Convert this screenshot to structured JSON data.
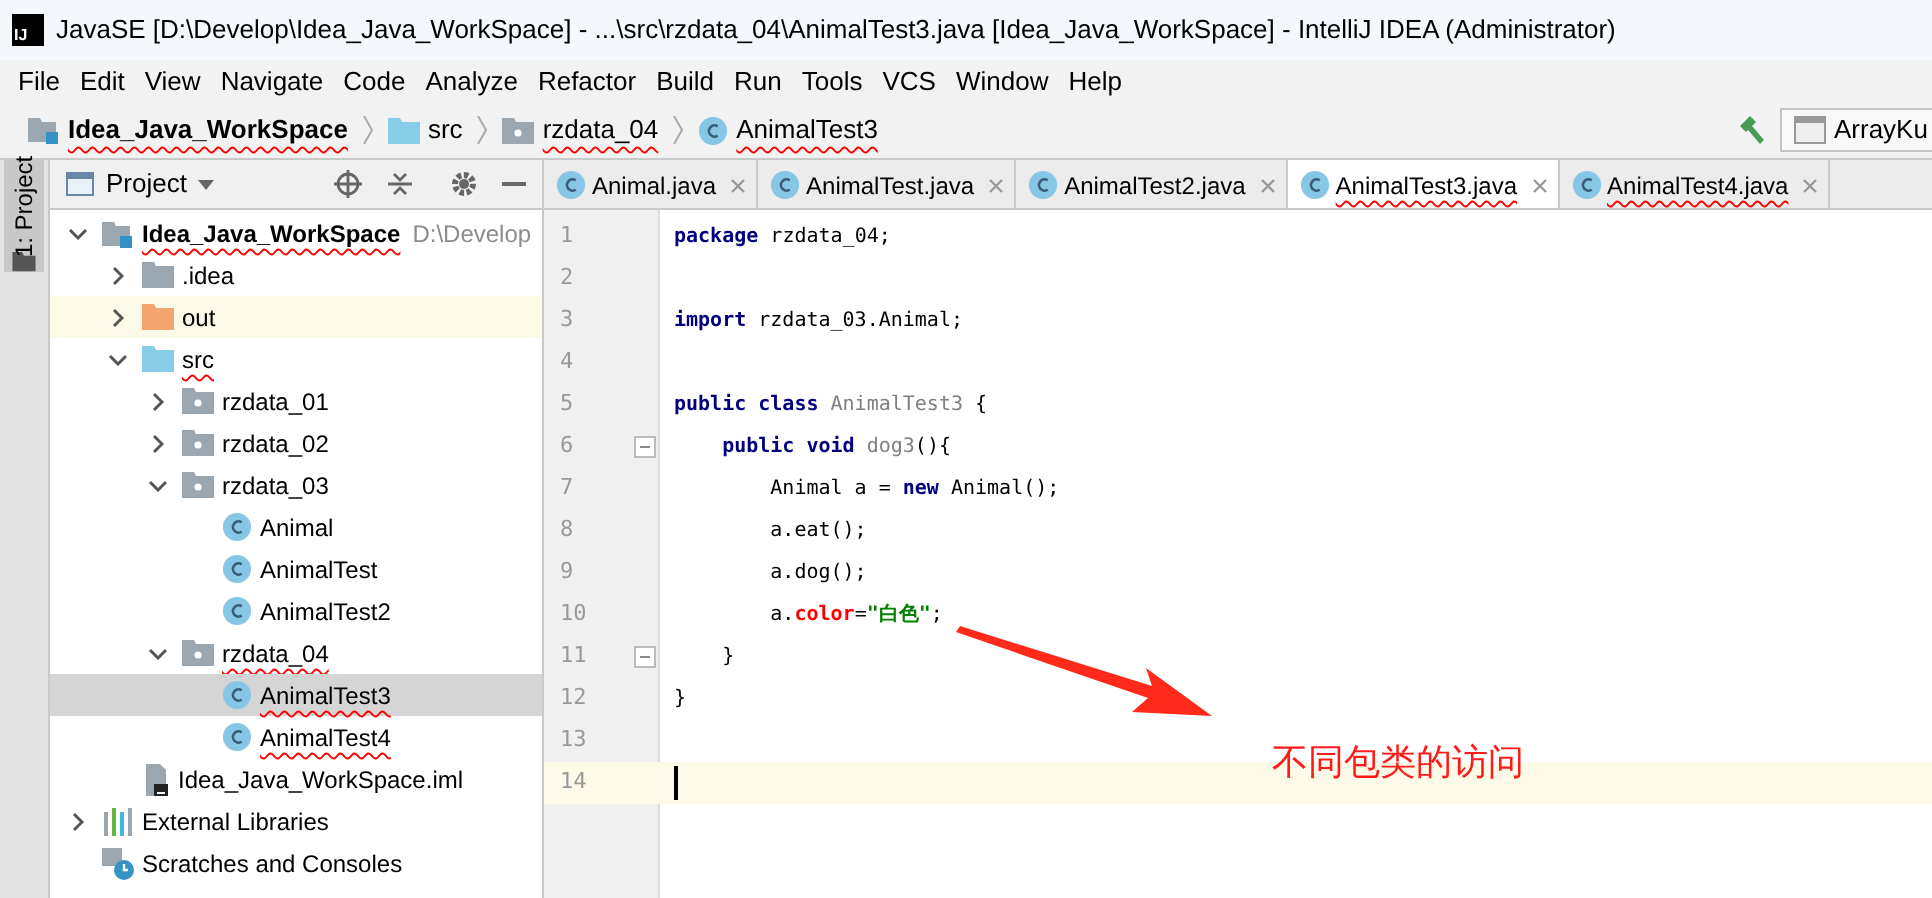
{
  "window": {
    "title": "JavaSE [D:\\Develop\\Idea_Java_WorkSpace] - ...\\src\\rzdata_04\\AnimalTest3.java [Idea_Java_WorkSpace] - IntelliJ IDEA (Administrator)",
    "app_icon": "IJ"
  },
  "menu": [
    "File",
    "Edit",
    "View",
    "Navigate",
    "Code",
    "Analyze",
    "Refactor",
    "Build",
    "Run",
    "Tools",
    "VCS",
    "Window",
    "Help"
  ],
  "breadcrumbs": [
    {
      "label": "Idea_Java_WorkSpace",
      "kind": "module",
      "error": true
    },
    {
      "label": "src",
      "kind": "source",
      "error": false
    },
    {
      "label": "rzdata_04",
      "kind": "package",
      "error": true
    },
    {
      "label": "AnimalTest3",
      "kind": "class",
      "error": true
    }
  ],
  "run_config": {
    "label": "ArrayKu"
  },
  "side_tab": {
    "label": "1: Project",
    "selected": true
  },
  "project_panel": {
    "title": "Project"
  },
  "tree": [
    {
      "label": "Idea_Java_WorkSpace",
      "path": "D:\\Develop",
      "kind": "module",
      "expanded": true,
      "error": true,
      "selected": false,
      "children": [
        {
          "label": ".idea",
          "kind": "folder",
          "expanded": false,
          "error": false,
          "selected": false
        },
        {
          "label": "out",
          "kind": "excluded",
          "expanded": false,
          "error": false,
          "selected": false
        },
        {
          "label": "src",
          "kind": "source",
          "expanded": true,
          "error": true,
          "selected": false,
          "children": [
            {
              "label": "rzdata_01",
              "kind": "package",
              "expanded": false,
              "error": false,
              "selected": false
            },
            {
              "label": "rzdata_02",
              "kind": "package",
              "expanded": false,
              "error": false,
              "selected": false
            },
            {
              "label": "rzdata_03",
              "kind": "package",
              "expanded": true,
              "error": false,
              "selected": false,
              "children": [
                {
                  "label": "Animal",
                  "kind": "class",
                  "error": false,
                  "selected": false
                },
                {
                  "label": "AnimalTest",
                  "kind": "class",
                  "error": false,
                  "selected": false
                },
                {
                  "label": "AnimalTest2",
                  "kind": "class",
                  "error": false,
                  "selected": false
                }
              ]
            },
            {
              "label": "rzdata_04",
              "kind": "package",
              "expanded": true,
              "error": true,
              "selected": false,
              "children": [
                {
                  "label": "AnimalTest3",
                  "kind": "class",
                  "error": true,
                  "selected": true
                },
                {
                  "label": "AnimalTest4",
                  "kind": "class",
                  "error": true,
                  "selected": false
                }
              ]
            }
          ]
        },
        {
          "label": "Idea_Java_WorkSpace.iml",
          "kind": "file",
          "error": false,
          "selected": false
        }
      ]
    },
    {
      "label": "External Libraries",
      "kind": "library",
      "expanded": false,
      "error": false,
      "selected": false
    },
    {
      "label": "Scratches and Consoles",
      "kind": "scratch",
      "error": false,
      "selected": false
    }
  ],
  "tabs": [
    {
      "label": "Animal.java",
      "selected": false,
      "error": false
    },
    {
      "label": "AnimalTest.java",
      "selected": false,
      "error": false
    },
    {
      "label": "AnimalTest2.java",
      "selected": false,
      "error": false
    },
    {
      "label": "AnimalTest3.java",
      "selected": true,
      "error": true
    },
    {
      "label": "AnimalTest4.java",
      "selected": false,
      "error": true
    }
  ],
  "editor": {
    "lines": [
      {
        "number": "1",
        "current": false,
        "tokens": [
          {
            "text": "package",
            "kind": "keyword"
          },
          {
            "text": " rzdata_04;",
            "kind": "plain"
          }
        ]
      },
      {
        "number": "2",
        "current": false
      },
      {
        "number": "3",
        "current": false,
        "tokens": [
          {
            "text": "import",
            "kind": "keyword"
          },
          {
            "text": " rzdata_03.Animal;",
            "kind": "plain"
          }
        ]
      },
      {
        "number": "4",
        "current": false
      },
      {
        "number": "5",
        "current": false,
        "tokens": [
          {
            "text": "public class",
            "kind": "keyword"
          },
          {
            "text": " AnimalTest3",
            "kind": "unused"
          },
          {
            "text": " {",
            "kind": "plain"
          }
        ]
      },
      {
        "number": "6",
        "current": false,
        "fold": true,
        "tokens": [
          {
            "text": "    public void",
            "kind": "keyword"
          },
          {
            "text": " dog3",
            "kind": "unused"
          },
          {
            "text": "(){",
            "kind": "plain"
          }
        ]
      },
      {
        "number": "7",
        "current": false,
        "tokens": [
          {
            "text": "        Animal a = ",
            "kind": "plain"
          },
          {
            "text": "new",
            "kind": "keyword"
          },
          {
            "text": " Animal();",
            "kind": "plain"
          }
        ]
      },
      {
        "number": "8",
        "current": false,
        "tokens": [
          {
            "text": "        a.eat();",
            "kind": "plain"
          }
        ]
      },
      {
        "number": "9",
        "current": false,
        "tokens": [
          {
            "text": "        a.dog();",
            "kind": "plain"
          }
        ]
      },
      {
        "number": "10",
        "current": false,
        "tokens": [
          {
            "text": "        a.",
            "kind": "plain"
          },
          {
            "text": "color",
            "kind": "field"
          },
          {
            "text": "=",
            "kind": "plain"
          },
          {
            "text": "\"白色\"",
            "kind": "string"
          },
          {
            "text": ";",
            "kind": "plain"
          }
        ]
      },
      {
        "number": "11",
        "current": false,
        "fold": true,
        "tokens": [
          {
            "text": "    }",
            "kind": "plain"
          }
        ]
      },
      {
        "number": "12",
        "current": false,
        "tokens": [
          {
            "text": "}",
            "kind": "plain"
          }
        ]
      },
      {
        "number": "13",
        "current": false
      },
      {
        "number": "14",
        "current": true
      }
    ]
  },
  "annotation": {
    "text": "不同包类的访问"
  }
}
